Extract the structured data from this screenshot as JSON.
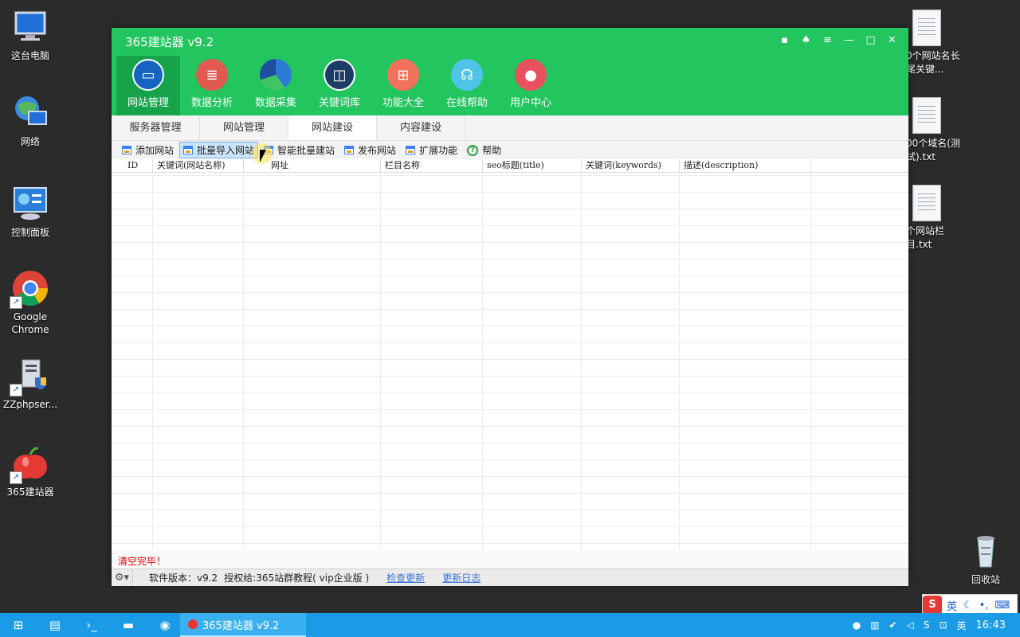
{
  "desktop": {
    "icons": [
      {
        "label": "这台电脑"
      },
      {
        "label": "网络"
      },
      {
        "label": "控制面板"
      },
      {
        "label": "Google Chrome"
      },
      {
        "label": "ZZphpser..."
      },
      {
        "label": "365建站器"
      }
    ],
    "files": [
      {
        "label": "0个网站名长尾关键..."
      },
      {
        "label": "00个域名(测试).txt"
      },
      {
        "label": "个网站栏目.txt"
      }
    ],
    "recycle_bin": "回收站"
  },
  "app": {
    "title": "365建站器 v9.2",
    "nav": [
      {
        "label": "网站管理"
      },
      {
        "label": "数据分析"
      },
      {
        "label": "数据采集"
      },
      {
        "label": "关键词库"
      },
      {
        "label": "功能大全"
      },
      {
        "label": "在线帮助"
      },
      {
        "label": "用户中心"
      }
    ],
    "tabs": [
      "服务器管理",
      "网站管理",
      "网站建设",
      "内容建设"
    ],
    "active_tab": "网站建设",
    "toolbar": [
      {
        "label": "添加网站"
      },
      {
        "label": "批量导入网站"
      },
      {
        "label": "智能批量建站"
      },
      {
        "label": "发布网站"
      },
      {
        "label": "扩展功能"
      },
      {
        "label": "帮助"
      }
    ],
    "grid": {
      "columns": [
        "ID",
        "关键词(网站名称)",
        "网址",
        "栏目名称",
        "seo标题(title)",
        "关键词(keywords)",
        "描述(description)"
      ],
      "rows": []
    },
    "status_message": "清空完毕！",
    "statusbar": {
      "version": "软件版本：v9.2",
      "license": "授权给:365站群教程( vip企业版 )",
      "check_update": "检查更新",
      "changelog": "更新日志"
    }
  },
  "taskbar": {
    "app_label": "365建站器 v9.2",
    "ime_lang": "英",
    "tray_lang": "英",
    "clock": "16:43"
  },
  "colors": {
    "titlebar_green": "#22c55e",
    "taskbar_blue": "#1b9be5",
    "status_red": "#dd0000"
  }
}
